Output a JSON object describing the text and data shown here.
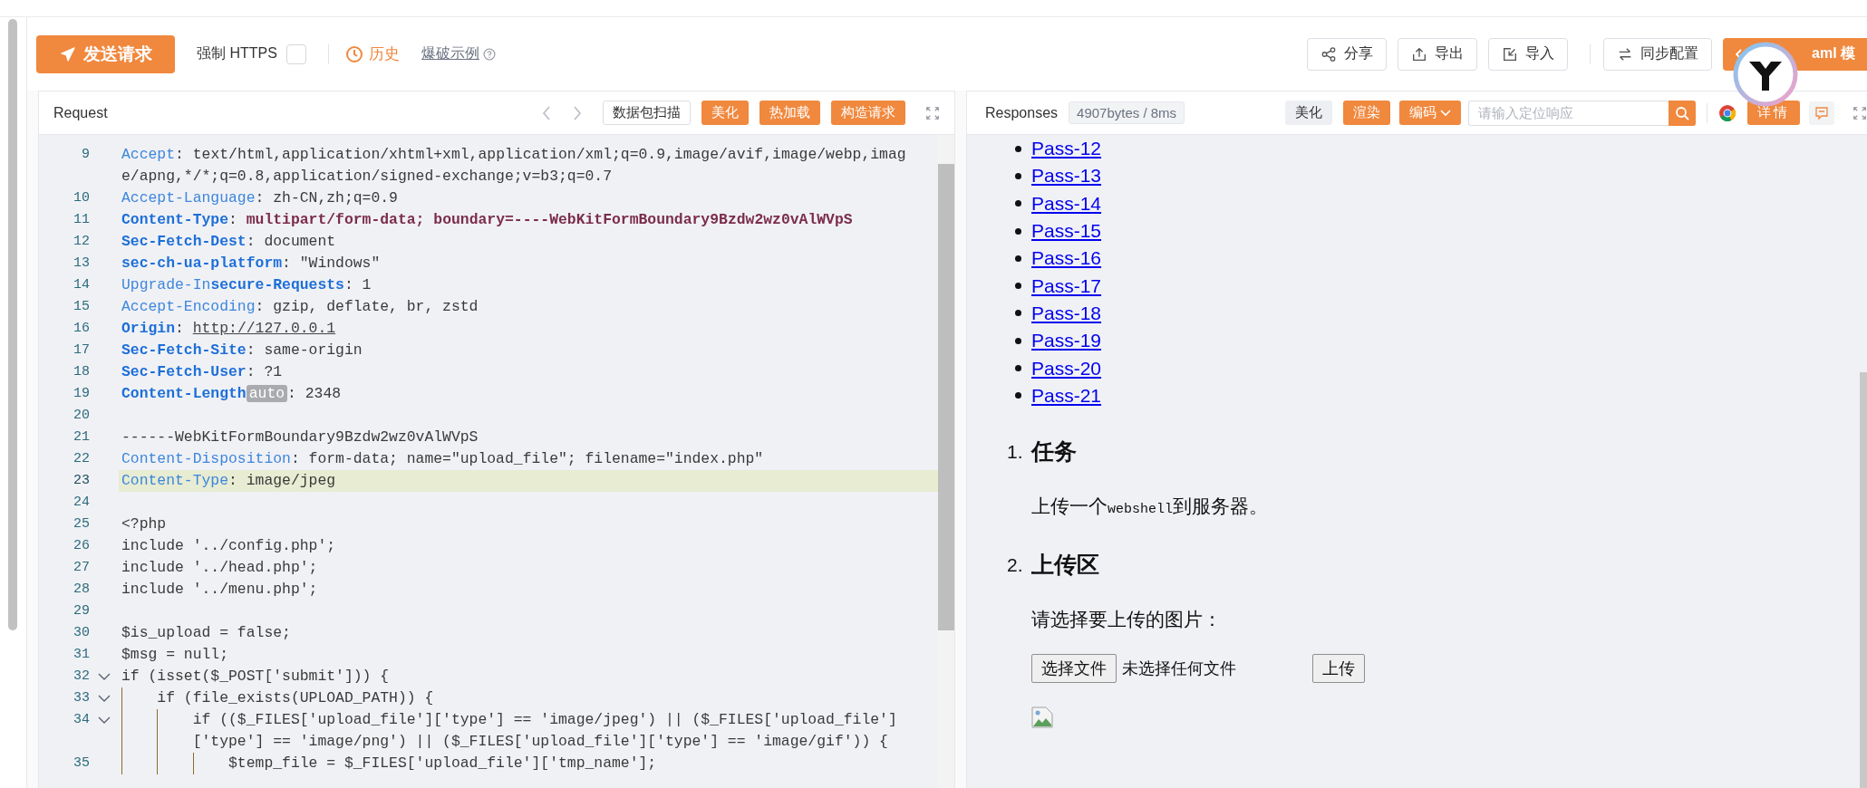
{
  "toolbar": {
    "send_button": "发送请求",
    "force_https": {
      "label": "强制 HTTPS",
      "checked": false
    },
    "history": "历史",
    "burst_example": "爆破示例",
    "actions": [
      {
        "label": "分享",
        "kind": "share"
      },
      {
        "label": "导出",
        "kind": "export"
      },
      {
        "label": "导入",
        "kind": "import"
      },
      {
        "label": "同步配置",
        "kind": "sync"
      }
    ],
    "generate_button": "aml 模"
  },
  "request": {
    "title": "Request",
    "actions": [
      {
        "label": "数据包扫描",
        "kind": "outline"
      },
      {
        "label": "美化",
        "kind": "primary"
      },
      {
        "label": "热加载",
        "kind": "primary"
      },
      {
        "label": "构造请求",
        "kind": "primary"
      }
    ],
    "lines": [
      {
        "number": "9",
        "current": false,
        "segments": [
          {
            "kind": "key",
            "text": "Accept"
          },
          {
            "kind": "plain",
            "text": ": text/html,application/xhtml+xml,application/xml;q=0.9,image/avif,image/webp,image/apng,*/*;q=0.8,application/signed-exchange;v=b3;q=0.7"
          }
        ]
      },
      {
        "number": "10",
        "current": false,
        "segments": [
          {
            "kind": "key",
            "text": "Accept-Language"
          },
          {
            "kind": "plain",
            "text": ": zh-CN,zh;q=0.9"
          }
        ]
      },
      {
        "number": "11",
        "current": false,
        "segments": [
          {
            "kind": "key-strong",
            "text": "Content-Type"
          },
          {
            "kind": "plain",
            "text": ": "
          },
          {
            "kind": "value-strong",
            "text": "multipart/form-data; boundary=----WebKitFormBoundary9Bzdw2wz0vAlWVpS"
          }
        ]
      },
      {
        "number": "12",
        "current": false,
        "segments": [
          {
            "kind": "key-strong",
            "text": "Sec-Fetch-Dest"
          },
          {
            "kind": "plain",
            "text": ": document"
          }
        ]
      },
      {
        "number": "13",
        "current": false,
        "segments": [
          {
            "kind": "key-strong",
            "text": "sec-ch-ua-platform"
          },
          {
            "kind": "plain",
            "text": ": \"Windows\""
          }
        ]
      },
      {
        "number": "14",
        "current": false,
        "segments": [
          {
            "kind": "key",
            "text": "Upgrade-In"
          },
          {
            "kind": "key-strong",
            "text": "secure-Requests"
          },
          {
            "kind": "plain",
            "text": ": 1"
          }
        ]
      },
      {
        "number": "15",
        "current": false,
        "segments": [
          {
            "kind": "key",
            "text": "Accept-Encoding"
          },
          {
            "kind": "plain",
            "text": ": gzip, deflate, br, zstd"
          }
        ]
      },
      {
        "number": "16",
        "current": false,
        "segments": [
          {
            "kind": "key-strong",
            "text": "Origin"
          },
          {
            "kind": "plain",
            "text": ": "
          },
          {
            "kind": "link",
            "text": "http://127.0.0.1"
          }
        ]
      },
      {
        "number": "17",
        "current": false,
        "segments": [
          {
            "kind": "key-strong",
            "text": "Sec-Fetch-Site"
          },
          {
            "kind": "plain",
            "text": ": same-origin"
          }
        ]
      },
      {
        "number": "18",
        "current": false,
        "segments": [
          {
            "kind": "key-strong",
            "text": "Sec-Fetch-User"
          },
          {
            "kind": "plain",
            "text": ": ?1"
          }
        ]
      },
      {
        "number": "19",
        "current": false,
        "segments": [
          {
            "kind": "key-strong",
            "text": "Content-Length"
          },
          {
            "kind": "badge",
            "text": "auto"
          },
          {
            "kind": "plain",
            "text": ": 2348"
          }
        ]
      },
      {
        "number": "20",
        "current": false
      },
      {
        "number": "21",
        "current": false,
        "segments": [
          {
            "kind": "plain",
            "text": "------WebKitFormBoundary9Bzdw2wz0vAlWVpS"
          }
        ]
      },
      {
        "number": "22",
        "current": false,
        "segments": [
          {
            "kind": "key",
            "text": "Content-Disposition"
          },
          {
            "kind": "plain",
            "text": ": form-data; name=\"upload_file\"; filename=\"index.php\""
          }
        ]
      },
      {
        "number": "23",
        "current": true,
        "segments": [
          {
            "kind": "key",
            "text": "Content-Type"
          },
          {
            "kind": "plain",
            "text": ": image/jpeg"
          }
        ]
      },
      {
        "number": "24",
        "current": false
      },
      {
        "number": "25",
        "current": false,
        "segments": [
          {
            "kind": "plain",
            "text": "<?php"
          }
        ]
      },
      {
        "number": "26",
        "current": false,
        "segments": [
          {
            "kind": "plain",
            "text": "include '../config.php';"
          }
        ]
      },
      {
        "number": "27",
        "current": false,
        "segments": [
          {
            "kind": "plain",
            "text": "include '../head.php';"
          }
        ]
      },
      {
        "number": "28",
        "current": false,
        "segments": [
          {
            "kind": "plain",
            "text": "include '../menu.php';"
          }
        ]
      },
      {
        "number": "29",
        "current": false
      },
      {
        "number": "30",
        "current": false,
        "segments": [
          {
            "kind": "plain",
            "text": "$is_upload = false;"
          }
        ]
      },
      {
        "number": "31",
        "current": false,
        "segments": [
          {
            "kind": "plain",
            "text": "$msg = null;"
          }
        ]
      },
      {
        "number": "32",
        "current": false,
        "expanded": true,
        "segments": [
          {
            "kind": "plain",
            "text": "if (isset($_POST['submit'])) {"
          }
        ]
      },
      {
        "number": "33",
        "current": false,
        "expanded": true,
        "segments": [
          {
            "kind": "plain",
            "text": "    if (file_exists(UPLOAD_PATH)) {"
          }
        ]
      },
      {
        "number": "34",
        "current": false,
        "expanded": true,
        "segments": [
          {
            "kind": "plain",
            "text": "        if (($_FILES['upload_file']['type'] == 'image/jpeg') || ($_FILES['upload_file']['type'] == 'image/png') || ($_FILES['upload_file']['type'] == 'image/gif')) {"
          }
        ]
      },
      {
        "number": "35",
        "current": false,
        "segments": [
          {
            "kind": "plain",
            "text": "            $temp_file = $_FILES['upload_file']['tmp_name'];"
          }
        ]
      }
    ]
  },
  "response": {
    "title": "Responses",
    "stats": "4907bytes / 8ms",
    "view_modes": [
      {
        "label": "美化",
        "selected": false
      },
      {
        "label": "渲染",
        "selected": true
      }
    ],
    "encoding": "编码",
    "search_placeholder": "请输入定位响应",
    "detail_button": "详情",
    "page": {
      "links": [
        "Pass-12",
        "Pass-13",
        "Pass-14",
        "Pass-15",
        "Pass-16",
        "Pass-17",
        "Pass-18",
        "Pass-19",
        "Pass-20",
        "Pass-21"
      ],
      "task": {
        "number": "1.",
        "title": "任务",
        "text": [
          {
            "kind": "text",
            "text": "上传一个"
          },
          {
            "kind": "code",
            "text": "webshell"
          },
          {
            "kind": "text",
            "text": "到服务器。"
          }
        ]
      },
      "upload": {
        "number": "2.",
        "title": "上传区",
        "prompt": "请选择要上传的图片：",
        "file_button": "选择文件",
        "file_status": "未选择任何文件",
        "upload_button": "上传"
      }
    }
  }
}
